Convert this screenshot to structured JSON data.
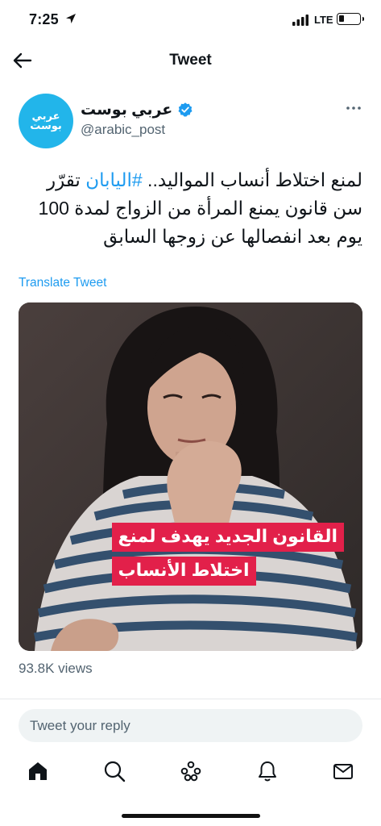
{
  "status_bar": {
    "time": "7:25",
    "network": "LTE"
  },
  "header": {
    "title": "Tweet"
  },
  "author": {
    "display_name": "عربي بوست",
    "handle": "@arabic_post",
    "avatar_logo": [
      "عربي",
      "بوست"
    ]
  },
  "tweet": {
    "text_before_hashtag": "لمنع اختلاط أنساب المواليد.. ",
    "hashtag": "#اليابان",
    "text_after_hashtag": " تقرّر سن قانون يمنع المرأة من الزواج لمدة 100 يوم بعد انفصالها عن زوجها السابق",
    "translate_label": "Translate Tweet",
    "media_caption": [
      "القانون الجديد يهدف لمنع",
      "اختلاط الأنساب"
    ],
    "views": "93.8K views"
  },
  "reply": {
    "placeholder": "Tweet your reply"
  },
  "tabs": [
    "home-icon",
    "search-icon",
    "spaces-icon",
    "notifications-icon",
    "messages-icon"
  ],
  "colors": {
    "accent": "#1d9bf0",
    "avatar_bg": "#22b5ea",
    "caption_bg": "#e2204a"
  }
}
